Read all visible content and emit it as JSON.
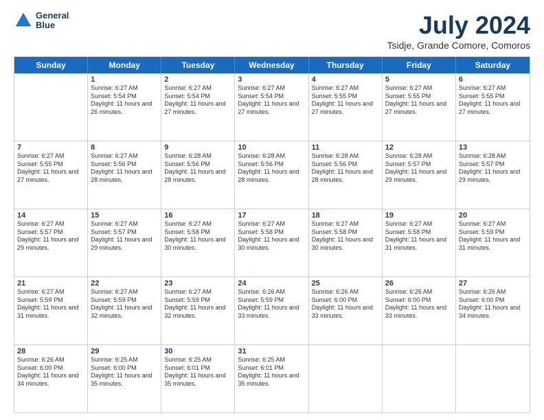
{
  "logo": {
    "line1": "General",
    "line2": "Blue"
  },
  "title": "July 2024",
  "subtitle": "Tsidje, Grande Comore, Comoros",
  "header_days": [
    "Sunday",
    "Monday",
    "Tuesday",
    "Wednesday",
    "Thursday",
    "Friday",
    "Saturday"
  ],
  "weeks": [
    [
      {
        "day": "",
        "sunrise": "",
        "sunset": "",
        "daylight": ""
      },
      {
        "day": "1",
        "sunrise": "Sunrise: 6:27 AM",
        "sunset": "Sunset: 5:54 PM",
        "daylight": "Daylight: 11 hours and 26 minutes."
      },
      {
        "day": "2",
        "sunrise": "Sunrise: 6:27 AM",
        "sunset": "Sunset: 5:54 PM",
        "daylight": "Daylight: 11 hours and 27 minutes."
      },
      {
        "day": "3",
        "sunrise": "Sunrise: 6:27 AM",
        "sunset": "Sunset: 5:54 PM",
        "daylight": "Daylight: 11 hours and 27 minutes."
      },
      {
        "day": "4",
        "sunrise": "Sunrise: 6:27 AM",
        "sunset": "Sunset: 5:55 PM",
        "daylight": "Daylight: 11 hours and 27 minutes."
      },
      {
        "day": "5",
        "sunrise": "Sunrise: 6:27 AM",
        "sunset": "Sunset: 5:55 PM",
        "daylight": "Daylight: 11 hours and 27 minutes."
      },
      {
        "day": "6",
        "sunrise": "Sunrise: 6:27 AM",
        "sunset": "Sunset: 5:55 PM",
        "daylight": "Daylight: 11 hours and 27 minutes."
      }
    ],
    [
      {
        "day": "7",
        "sunrise": "Sunrise: 6:27 AM",
        "sunset": "Sunset: 5:55 PM",
        "daylight": "Daylight: 11 hours and 27 minutes."
      },
      {
        "day": "8",
        "sunrise": "Sunrise: 6:27 AM",
        "sunset": "Sunset: 5:56 PM",
        "daylight": "Daylight: 11 hours and 28 minutes."
      },
      {
        "day": "9",
        "sunrise": "Sunrise: 6:28 AM",
        "sunset": "Sunset: 5:56 PM",
        "daylight": "Daylight: 11 hours and 28 minutes."
      },
      {
        "day": "10",
        "sunrise": "Sunrise: 6:28 AM",
        "sunset": "Sunset: 5:56 PM",
        "daylight": "Daylight: 11 hours and 28 minutes."
      },
      {
        "day": "11",
        "sunrise": "Sunrise: 6:28 AM",
        "sunset": "Sunset: 5:56 PM",
        "daylight": "Daylight: 11 hours and 28 minutes."
      },
      {
        "day": "12",
        "sunrise": "Sunrise: 6:28 AM",
        "sunset": "Sunset: 5:57 PM",
        "daylight": "Daylight: 11 hours and 29 minutes."
      },
      {
        "day": "13",
        "sunrise": "Sunrise: 6:28 AM",
        "sunset": "Sunset: 5:57 PM",
        "daylight": "Daylight: 11 hours and 29 minutes."
      }
    ],
    [
      {
        "day": "14",
        "sunrise": "Sunrise: 6:27 AM",
        "sunset": "Sunset: 5:57 PM",
        "daylight": "Daylight: 11 hours and 29 minutes."
      },
      {
        "day": "15",
        "sunrise": "Sunrise: 6:27 AM",
        "sunset": "Sunset: 5:57 PM",
        "daylight": "Daylight: 11 hours and 29 minutes."
      },
      {
        "day": "16",
        "sunrise": "Sunrise: 6:27 AM",
        "sunset": "Sunset: 5:58 PM",
        "daylight": "Daylight: 11 hours and 30 minutes."
      },
      {
        "day": "17",
        "sunrise": "Sunrise: 6:27 AM",
        "sunset": "Sunset: 5:58 PM",
        "daylight": "Daylight: 11 hours and 30 minutes."
      },
      {
        "day": "18",
        "sunrise": "Sunrise: 6:27 AM",
        "sunset": "Sunset: 5:58 PM",
        "daylight": "Daylight: 11 hours and 30 minutes."
      },
      {
        "day": "19",
        "sunrise": "Sunrise: 6:27 AM",
        "sunset": "Sunset: 5:58 PM",
        "daylight": "Daylight: 11 hours and 31 minutes."
      },
      {
        "day": "20",
        "sunrise": "Sunrise: 6:27 AM",
        "sunset": "Sunset: 5:59 PM",
        "daylight": "Daylight: 11 hours and 31 minutes."
      }
    ],
    [
      {
        "day": "21",
        "sunrise": "Sunrise: 6:27 AM",
        "sunset": "Sunset: 5:59 PM",
        "daylight": "Daylight: 11 hours and 31 minutes."
      },
      {
        "day": "22",
        "sunrise": "Sunrise: 6:27 AM",
        "sunset": "Sunset: 5:59 PM",
        "daylight": "Daylight: 11 hours and 32 minutes."
      },
      {
        "day": "23",
        "sunrise": "Sunrise: 6:27 AM",
        "sunset": "Sunset: 5:59 PM",
        "daylight": "Daylight: 11 hours and 32 minutes."
      },
      {
        "day": "24",
        "sunrise": "Sunrise: 6:26 AM",
        "sunset": "Sunset: 5:59 PM",
        "daylight": "Daylight: 11 hours and 33 minutes."
      },
      {
        "day": "25",
        "sunrise": "Sunrise: 6:26 AM",
        "sunset": "Sunset: 6:00 PM",
        "daylight": "Daylight: 11 hours and 33 minutes."
      },
      {
        "day": "26",
        "sunrise": "Sunrise: 6:26 AM",
        "sunset": "Sunset: 6:00 PM",
        "daylight": "Daylight: 11 hours and 33 minutes."
      },
      {
        "day": "27",
        "sunrise": "Sunrise: 6:26 AM",
        "sunset": "Sunset: 6:00 PM",
        "daylight": "Daylight: 11 hours and 34 minutes."
      }
    ],
    [
      {
        "day": "28",
        "sunrise": "Sunrise: 6:26 AM",
        "sunset": "Sunset: 6:00 PM",
        "daylight": "Daylight: 11 hours and 34 minutes."
      },
      {
        "day": "29",
        "sunrise": "Sunrise: 6:25 AM",
        "sunset": "Sunset: 6:00 PM",
        "daylight": "Daylight: 11 hours and 35 minutes."
      },
      {
        "day": "30",
        "sunrise": "Sunrise: 6:25 AM",
        "sunset": "Sunset: 6:01 PM",
        "daylight": "Daylight: 11 hours and 35 minutes."
      },
      {
        "day": "31",
        "sunrise": "Sunrise: 6:25 AM",
        "sunset": "Sunset: 6:01 PM",
        "daylight": "Daylight: 11 hours and 35 minutes."
      },
      {
        "day": "",
        "sunrise": "",
        "sunset": "",
        "daylight": ""
      },
      {
        "day": "",
        "sunrise": "",
        "sunset": "",
        "daylight": ""
      },
      {
        "day": "",
        "sunrise": "",
        "sunset": "",
        "daylight": ""
      }
    ]
  ]
}
